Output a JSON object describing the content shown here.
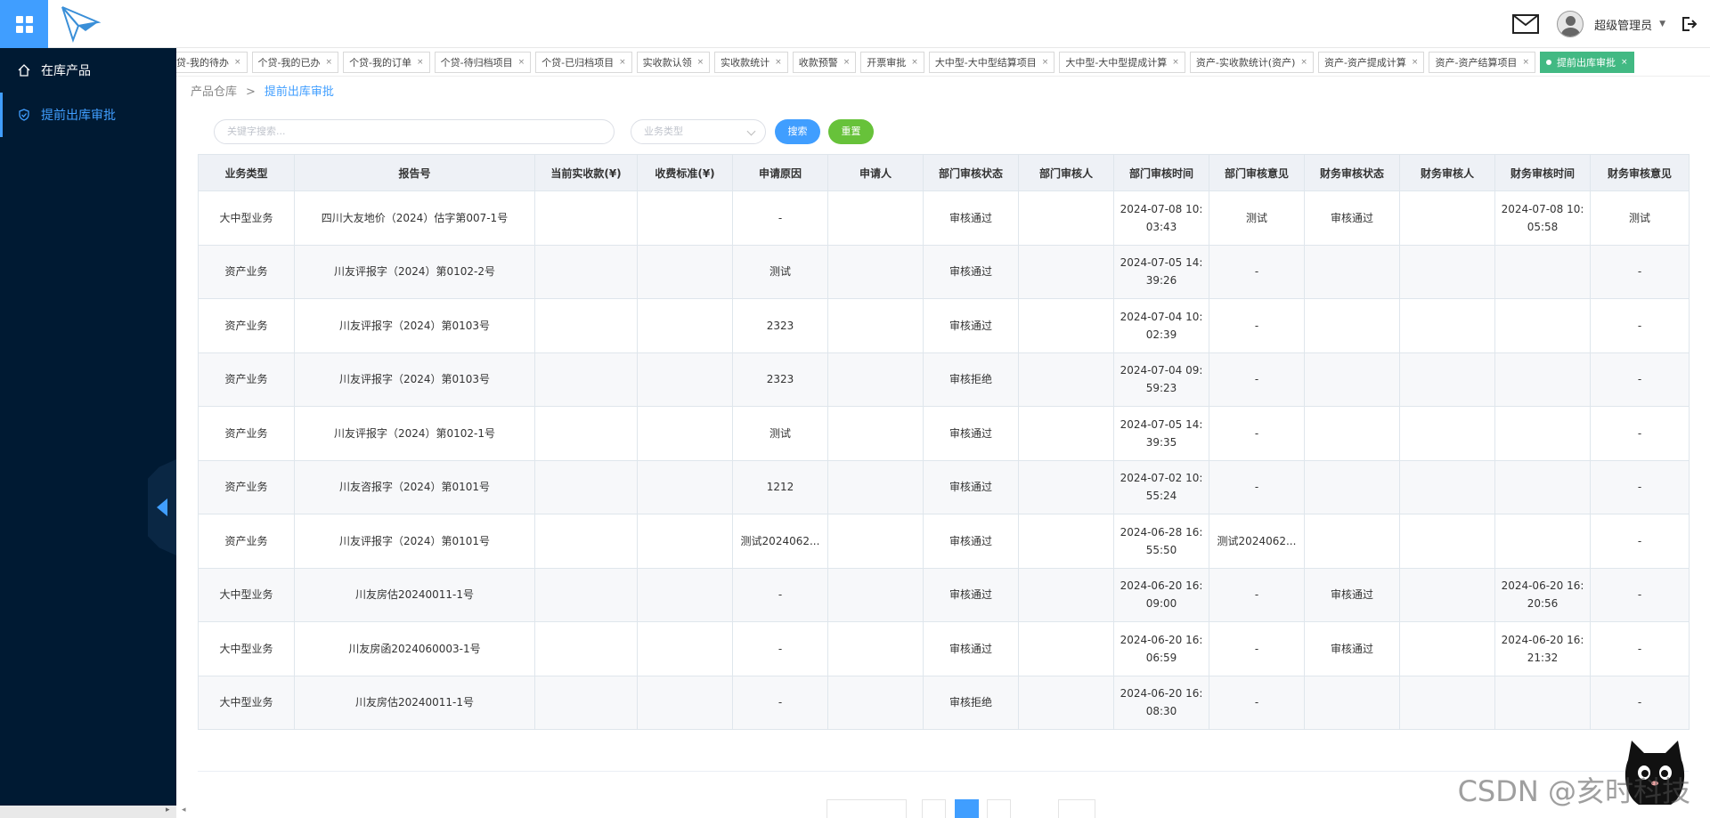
{
  "header": {
    "username": "超级管理员"
  },
  "sidebar": {
    "items": [
      {
        "label": "在库产品",
        "icon": "home-icon"
      },
      {
        "label": "提前出库审批",
        "icon": "shield-check-icon"
      }
    ]
  },
  "tabs": [
    "贷-我的待办",
    "个贷-我的已办",
    "个贷-我的订单",
    "个贷-待归档项目",
    "个贷-已归档项目",
    "实收款认领",
    "实收款统计",
    "收款预警",
    "开票审批",
    "大中型-大中型结算项目",
    "大中型-大中型提成计算",
    "资产-实收款统计(资产)",
    "资产-资产提成计算",
    "资产-资产结算项目",
    "提前出库审批"
  ],
  "breadcrumb": {
    "parent": "产品仓库",
    "sep": ">",
    "current": "提前出库审批"
  },
  "filters": {
    "keyword_placeholder": "关键字搜索...",
    "type_placeholder": "业务类型",
    "search_label": "搜索",
    "reset_label": "重置"
  },
  "table": {
    "columns": [
      "业务类型",
      "报告号",
      "当前实收款(¥)",
      "收费标准(¥)",
      "申请原因",
      "申请人",
      "部门审核状态",
      "部门审核人",
      "部门审核时间",
      "部门审核意见",
      "财务审核状态",
      "财务审核人",
      "财务审核时间",
      "财务审核意见"
    ],
    "rows": [
      [
        "大中型业务",
        "四川大友地价（2024）估字第007-1号",
        "",
        "",
        "-",
        "",
        "审核通过",
        "",
        "2024-07-08 10:03:43",
        "测试",
        "审核通过",
        "",
        "2024-07-08 10:05:58",
        "测试"
      ],
      [
        "资产业务",
        "川友评报字（2024）第0102-2号",
        "",
        "",
        "测试",
        "",
        "审核通过",
        "",
        "2024-07-05 14:39:26",
        "-",
        "",
        "",
        "",
        "-"
      ],
      [
        "资产业务",
        "川友评报字（2024）第0103号",
        "",
        "",
        "2323",
        "",
        "审核通过",
        "",
        "2024-07-04 10:02:39",
        "-",
        "",
        "",
        "",
        "-"
      ],
      [
        "资产业务",
        "川友评报字（2024）第0103号",
        "",
        "",
        "2323",
        "",
        "审核拒绝",
        "",
        "2024-07-04 09:59:23",
        "-",
        "",
        "",
        "",
        "-"
      ],
      [
        "资产业务",
        "川友评报字（2024）第0102-1号",
        "",
        "",
        "测试",
        "",
        "审核通过",
        "",
        "2024-07-05 14:39:35",
        "-",
        "",
        "",
        "",
        "-"
      ],
      [
        "资产业务",
        "川友咨报字（2024）第0101号",
        "",
        "",
        "1212",
        "",
        "审核通过",
        "",
        "2024-07-02 10:55:24",
        "-",
        "",
        "",
        "",
        "-"
      ],
      [
        "资产业务",
        "川友评报字（2024）第0101号",
        "",
        "",
        "测试2024062...",
        "",
        "审核通过",
        "",
        "2024-06-28 16:55:50",
        "测试2024062...",
        "",
        "",
        "",
        "-"
      ],
      [
        "大中型业务",
        "川友房估20240011-1号",
        "",
        "",
        "-",
        "",
        "审核通过",
        "",
        "2024-06-20 16:09:00",
        "-",
        "审核通过",
        "",
        "2024-06-20 16:20:56",
        "-"
      ],
      [
        "大中型业务",
        "川友房函2024060003-1号",
        "",
        "",
        "-",
        "",
        "审核通过",
        "",
        "2024-06-20 16:06:59",
        "-",
        "审核通过",
        "",
        "2024-06-20 16:21:32",
        "-"
      ],
      [
        "大中型业务",
        "川友房估20240011-1号",
        "",
        "",
        "-",
        "",
        "审核拒绝",
        "",
        "2024-06-20 16:08:30",
        "-",
        "",
        "",
        "",
        "-"
      ]
    ]
  },
  "watermark": "CSDN @亥时科技"
}
